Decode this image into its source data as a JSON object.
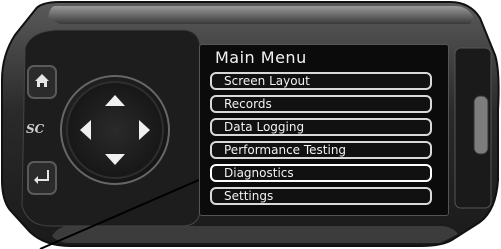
{
  "device": {
    "logo": "SC"
  },
  "screen": {
    "title": "Main Menu",
    "items": [
      {
        "label": "Screen Layout"
      },
      {
        "label": "Records"
      },
      {
        "label": "Data Logging"
      },
      {
        "label": "Performance Testing"
      },
      {
        "label": "Diagnostics"
      },
      {
        "label": "Settings"
      }
    ]
  },
  "icons": {
    "home": "home-icon",
    "back": "back-arrow-icon",
    "up": "up-arrow-icon",
    "down": "down-arrow-icon",
    "left": "left-arrow-icon",
    "right": "right-arrow-icon"
  }
}
